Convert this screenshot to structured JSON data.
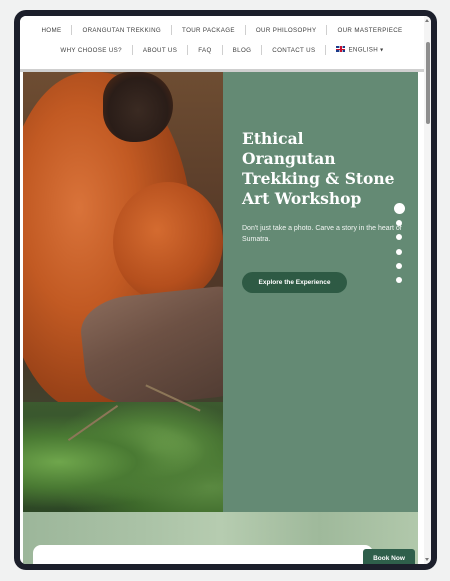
{
  "nav": {
    "row1": [
      "HOME",
      "ORANGUTAN TREKKING",
      "TOUR PACKAGE",
      "OUR PHILOSOPHY",
      "OUR MASTERPIECE"
    ],
    "row2": [
      "WHY CHOOSE US?",
      "ABOUT US",
      "FAQ",
      "BLOG",
      "CONTACT US"
    ],
    "language": "ENGLISH",
    "language_caret": "▾"
  },
  "hero": {
    "title": "Ethical Orangutan Trekking & Stone Art Workshop",
    "subtitle": "Don't just take a photo. Carve a story in the heart of Sumatra.",
    "cta_label": "Explore the Experience",
    "slides_total": 6,
    "slide_active": 1,
    "panel_color": "#648a74",
    "cta_color": "#2e5a44"
  },
  "book_now_label": "Book Now",
  "book_now_color": "#2f5f4b"
}
